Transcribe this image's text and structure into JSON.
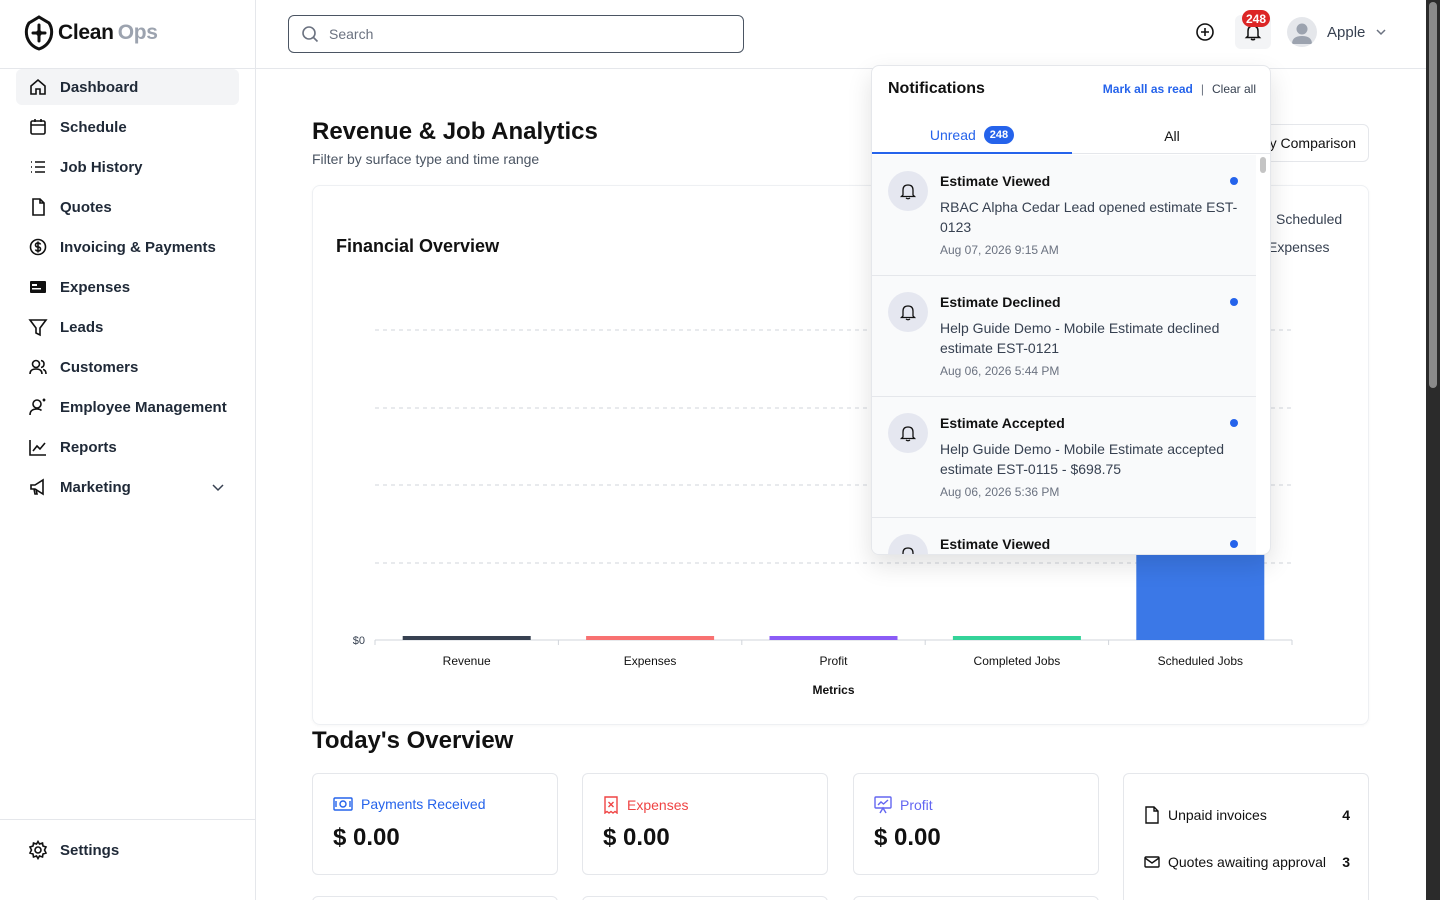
{
  "app": {
    "logo_word1": "Clean",
    "logo_word2": "Ops"
  },
  "sidebar": {
    "items": [
      {
        "label": "Dashboard",
        "icon": "home-icon",
        "active": true
      },
      {
        "label": "Schedule",
        "icon": "calendar-icon"
      },
      {
        "label": "Job History",
        "icon": "list-icon"
      },
      {
        "label": "Quotes",
        "icon": "document-icon"
      },
      {
        "label": "Invoicing & Payments",
        "icon": "dollar-circle-icon"
      },
      {
        "label": "Expenses",
        "icon": "receipt-icon"
      },
      {
        "label": "Leads",
        "icon": "filter-icon"
      },
      {
        "label": "Customers",
        "icon": "users-icon"
      },
      {
        "label": "Employee Management",
        "icon": "user-manage-icon"
      },
      {
        "label": "Reports",
        "icon": "chart-line-icon"
      },
      {
        "label": "Marketing",
        "icon": "megaphone-icon",
        "has_children": true
      }
    ],
    "settings_label": "Settings"
  },
  "header": {
    "search_placeholder": "Search",
    "notification_count": "248",
    "user_name": "Apple"
  },
  "main": {
    "title": "Revenue & Job Analytics",
    "subtitle": "Filter by surface type and time range",
    "comparison_button": "y Comparison",
    "chart_card_title": "Financial Overview",
    "legend_visible_1": "Scheduled",
    "legend_visible_2": "Expenses"
  },
  "chart_data": {
    "type": "bar",
    "categories": [
      "Revenue",
      "Expenses",
      "Profit",
      "Completed Jobs",
      "Scheduled Jobs"
    ],
    "values": [
      0,
      0,
      0,
      0,
      4
    ],
    "colors": [
      "#374151",
      "#f87171",
      "#8b5cf6",
      "#34d399",
      "#3b78e7"
    ],
    "xlabel": "Metrics",
    "y_tick_labels": [
      "$0"
    ],
    "grid": true
  },
  "overview": {
    "title": "Today's Overview",
    "cards": [
      {
        "label": "Payments Received",
        "value": "$ 0.00",
        "color": "#2563eb",
        "icon": "money-icon"
      },
      {
        "label": "Expenses",
        "value": "$ 0.00",
        "color": "#ef4444",
        "icon": "receipt-x-icon"
      },
      {
        "label": "Profit",
        "value": "$ 0.00",
        "color": "#6366f1",
        "icon": "trend-board-icon"
      }
    ],
    "summary": [
      {
        "label": "Unpaid invoices",
        "count": "4",
        "icon": "file-icon"
      },
      {
        "label": "Quotes awaiting approval",
        "count": "3",
        "icon": "mail-icon"
      }
    ]
  },
  "notifications": {
    "title": "Notifications",
    "mark_all_read": "Mark all as read",
    "separator": "|",
    "clear_all": "Clear all",
    "tabs": [
      {
        "label": "Unread",
        "badge": "248",
        "active": true
      },
      {
        "label": "All"
      }
    ],
    "items": [
      {
        "title": "Estimate Viewed",
        "message": "RBAC Alpha Cedar Lead opened estimate EST-0123",
        "time": "Aug 07, 2026 9:15 AM"
      },
      {
        "title": "Estimate Declined",
        "message": "Help Guide Demo - Mobile Estimate declined estimate EST-0121",
        "time": "Aug 06, 2026 5:44 PM"
      },
      {
        "title": "Estimate Accepted",
        "message": "Help Guide Demo - Mobile Estimate accepted estimate EST-0115 - $698.75",
        "time": "Aug 06, 2026 5:36 PM"
      },
      {
        "title": "Estimate Viewed",
        "message": "",
        "time": ""
      }
    ]
  }
}
